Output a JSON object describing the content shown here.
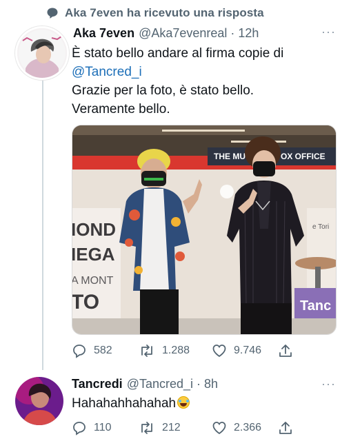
{
  "context": {
    "text": "Aka 7even ha ricevuto una risposta",
    "icon": "speech-bubble-icon"
  },
  "tweet1": {
    "name": "Aka 7even",
    "handle": "@Aka7evenreal · 12h",
    "text_line1": "È stato bello andare al firma copie di",
    "mention": "@Tancred_i",
    "text_line2": "Grazie per la foto, è stato bello.",
    "text_line3": "Veramente bello.",
    "more": "···",
    "photo_signs": {
      "banner": "THE MU",
      "box_office": "OX OFFICE",
      "left_sign": [
        "IOND",
        "IEGA",
        "A MONT",
        "TO"
      ],
      "right_sign": "e Tori",
      "purple_sign": "Tanc"
    },
    "actions": {
      "replies": "582",
      "retweets": "1.288",
      "likes": "9.746"
    }
  },
  "tweet2": {
    "name": "Tancredi",
    "handle": "@Tancred_i · 8h",
    "text": "Hahahahhahahah",
    "more": "···",
    "actions": {
      "replies": "110",
      "retweets": "212",
      "likes": "2.366"
    }
  },
  "colors": {
    "link": "#1d6fb8",
    "muted": "#536471",
    "thread_line": "#cfd9de",
    "accent_purple": "#8a6fb6"
  }
}
